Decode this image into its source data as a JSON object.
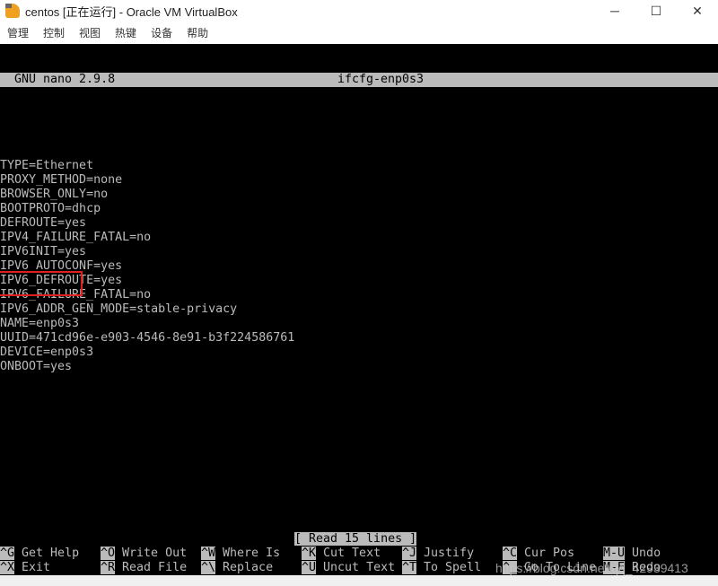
{
  "window": {
    "title": "centos [正在运行] - Oracle VM VirtualBox",
    "minimize": "─",
    "maximize": "☐",
    "close": "✕"
  },
  "menu": [
    "管理",
    "控制",
    "视图",
    "热键",
    "设备",
    "帮助"
  ],
  "nano": {
    "version": "GNU nano 2.9.8",
    "filename": "ifcfg-enp0s3",
    "lines": [
      "TYPE=Ethernet",
      "PROXY_METHOD=none",
      "BROWSER_ONLY=no",
      "BOOTPROTO=dhcp",
      "DEFROUTE=yes",
      "IPV4_FAILURE_FATAL=no",
      "IPV6INIT=yes",
      "IPV6_AUTOCONF=yes",
      "IPV6_DEFROUTE=yes",
      "IPV6_FAILURE_FATAL=no",
      "IPV6_ADDR_GEN_MODE=stable-privacy",
      "NAME=enp0s3",
      "UUID=471cd96e-e903-4546-8e91-b3f224586761",
      "DEVICE=enp0s3",
      "ONBOOT=yes"
    ],
    "status": "[ Read 15 lines ]",
    "shortcuts_row1": [
      {
        "key": "^G",
        "label": "Get Help"
      },
      {
        "key": "^O",
        "label": "Write Out"
      },
      {
        "key": "^W",
        "label": "Where Is"
      },
      {
        "key": "^K",
        "label": "Cut Text"
      },
      {
        "key": "^J",
        "label": "Justify"
      },
      {
        "key": "^C",
        "label": "Cur Pos"
      },
      {
        "key": "M-U",
        "label": "Undo"
      }
    ],
    "shortcuts_row2": [
      {
        "key": "^X",
        "label": "Exit"
      },
      {
        "key": "^R",
        "label": "Read File"
      },
      {
        "key": "^\\",
        "label": "Replace"
      },
      {
        "key": "^U",
        "label": "Uncut Text"
      },
      {
        "key": "^T",
        "label": "To Spell"
      },
      {
        "key": "^_",
        "label": "Go To Line"
      },
      {
        "key": "M-E",
        "label": "Redo"
      }
    ]
  },
  "watermark": "https://blog.csdn.net/qq_42939413",
  "colors": {
    "highlight": "#e02020",
    "terminal_bg": "#000000",
    "terminal_fg": "#bbbbbb"
  }
}
